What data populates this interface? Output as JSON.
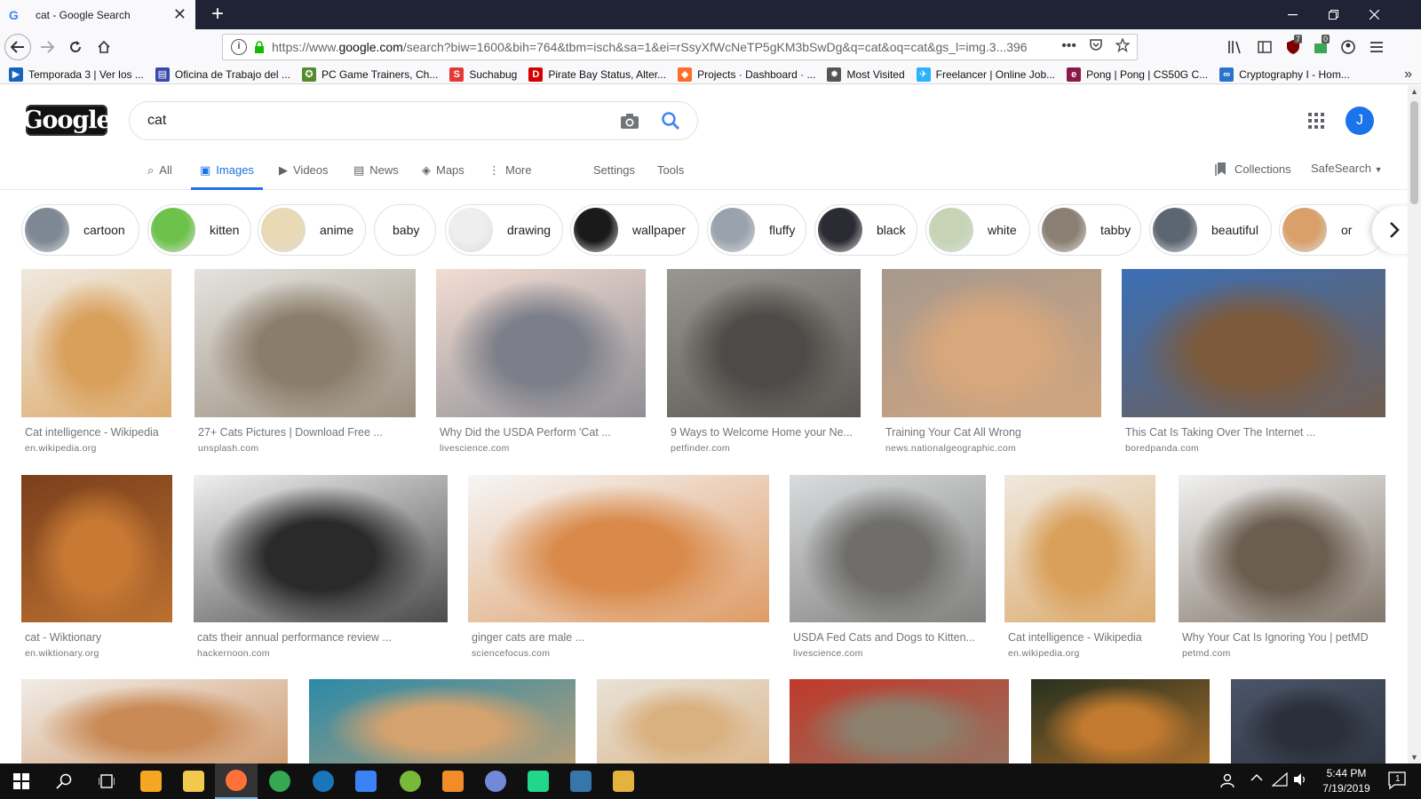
{
  "browser": {
    "tab_title": "cat - Google Search",
    "tab_favicon": "G",
    "tab_close": "✕",
    "new_tab": "+",
    "url_host_prefix": "https://www.",
    "url_host": "google.com",
    "url_path": "/search?biw=1600&bih=764&tbm=isch&sa=1&ei=rSsyXfWcNeTP5gKM3bSwDg&q=cat&oq=cat&gs_l=img.3...396",
    "url_more": "•••",
    "badge_ublock": "7",
    "badge_ext": "0"
  },
  "bookmarks": [
    {
      "label": "Temporada 3 | Ver los ...",
      "color": "#1565c0",
      "icon": "▶"
    },
    {
      "label": "Oficina de Trabajo del ...",
      "color": "#3949ab",
      "icon": "▤"
    },
    {
      "label": "PC Game Trainers, Ch...",
      "color": "#558b2f",
      "icon": "✪"
    },
    {
      "label": "Suchabug",
      "color": "#e53935",
      "icon": "S"
    },
    {
      "label": "Pirate Bay Status, Alter...",
      "color": "#d50000",
      "icon": "D"
    },
    {
      "label": "Projects · Dashboard · ...",
      "color": "#fc6d26",
      "icon": "◆"
    },
    {
      "label": "Most Visited",
      "color": "#555555",
      "icon": "✹"
    },
    {
      "label": "Freelancer | Online Job...",
      "color": "#29b2fe",
      "icon": "✈"
    },
    {
      "label": "Pong | Pong | CS50G C...",
      "color": "#8b1a4a",
      "icon": "e"
    },
    {
      "label": "Cryptography I - Hom...",
      "color": "#2a73cc",
      "icon": "∞"
    }
  ],
  "google": {
    "logo_text": "Google",
    "query": "cat",
    "avatar_letter": "J",
    "tabs": [
      {
        "label": "All",
        "icon": "⌕"
      },
      {
        "label": "Images",
        "icon": "▣"
      },
      {
        "label": "Videos",
        "icon": "▶"
      },
      {
        "label": "News",
        "icon": "▤"
      },
      {
        "label": "Maps",
        "icon": "◈"
      },
      {
        "label": "More",
        "icon": "⋮"
      }
    ],
    "settings": "Settings",
    "tools": "Tools",
    "collections": "Collections",
    "safesearch": "SafeSearch",
    "accent": "#1a73e8"
  },
  "chips": [
    {
      "label": "cartoon",
      "thumb": "#7d8894"
    },
    {
      "label": "kitten",
      "thumb": "#6cc24a"
    },
    {
      "label": "anime",
      "thumb": "#e9d9b4"
    },
    {
      "label": "baby",
      "thumb": ""
    },
    {
      "label": "drawing",
      "thumb": "#eeeeee"
    },
    {
      "label": "wallpaper",
      "thumb": "#1a1a1a"
    },
    {
      "label": "fluffy",
      "thumb": "#9aa3ad"
    },
    {
      "label": "black",
      "thumb": "#2b2b33"
    },
    {
      "label": "white",
      "thumb": "#c6d4b5"
    },
    {
      "label": "tabby",
      "thumb": "#8a7f72"
    },
    {
      "label": "beautiful",
      "thumb": "#5c6672"
    },
    {
      "label": "or",
      "thumb": "#d9a06a"
    }
  ],
  "results": [
    {
      "title": "Cat intelligence - Wikipedia",
      "domain": "en.wikipedia.org",
      "c1": "#d9a05b",
      "c2": "#efe9df"
    },
    {
      "title": "27+ Cats Pictures | Download Free ...",
      "domain": "unsplash.com",
      "c1": "#8b7d6b",
      "c2": "#e5e3df"
    },
    {
      "title": "Why Did the USDA Perform 'Cat ...",
      "domain": "livescience.com",
      "c1": "#7c7f89",
      "c2": "#f3ddd3"
    },
    {
      "title": "9 Ways to Welcome Home your Ne...",
      "domain": "petfinder.com",
      "c1": "#4d4b47",
      "c2": "#9a9791"
    },
    {
      "title": "Training Your Cat All Wrong",
      "domain": "news.nationalgeographic.com",
      "c1": "#d8a77c",
      "c2": "#a6998e"
    },
    {
      "title": "This Cat Is Taking Over The Internet ...",
      "domain": "boredpanda.com",
      "c1": "#7c5a3b",
      "c2": "#3b6fb6"
    },
    {
      "title": "cat - Wiktionary",
      "domain": "en.wiktionary.org",
      "c1": "#c87a34",
      "c2": "#7a3f1c"
    },
    {
      "title": "cats their annual performance review ...",
      "domain": "hackernoon.com",
      "c1": "#2a2a2a",
      "c2": "#f0f0f0"
    },
    {
      "title": "ginger cats are male ...",
      "domain": "sciencefocus.com",
      "c1": "#d98a4a",
      "c2": "#f6f6f6"
    },
    {
      "title": "USDA Fed Cats and Dogs to Kitten...",
      "domain": "livescience.com",
      "c1": "#6f6e6b",
      "c2": "#d9dcde"
    },
    {
      "title": "Cat intelligence - Wikipedia",
      "domain": "en.wikipedia.org",
      "c1": "#d9a05b",
      "c2": "#efe9df"
    },
    {
      "title": "Why Your Cat Is Ignoring You | petMD",
      "domain": "petmd.com",
      "c1": "#6b5d4f",
      "c2": "#f2f2f2"
    },
    {
      "title": "",
      "domain": "",
      "c1": "#c98a56",
      "c2": "#f1ede8"
    },
    {
      "title": "",
      "domain": "",
      "c1": "#d4a26e",
      "c2": "#2a8aa8"
    },
    {
      "title": "",
      "domain": "",
      "c1": "#d9b07f",
      "c2": "#e8e2d8"
    },
    {
      "title": "",
      "domain": "",
      "c1": "#8c7f6c",
      "c2": "#c0392b"
    },
    {
      "title": "",
      "domain": "",
      "c1": "#c17a2f",
      "c2": "#26301f"
    },
    {
      "title": "",
      "domain": "",
      "c1": "#2b2f3a",
      "c2": "#4a5568"
    }
  ],
  "taskbar": {
    "time": "5:44 PM",
    "date": "7/19/2019",
    "notif_count": "1",
    "apps": [
      {
        "name": "start",
        "color": "#ffffff"
      },
      {
        "name": "search",
        "color": "#ffffff"
      },
      {
        "name": "task-view",
        "color": "#ffffff"
      },
      {
        "name": "media-player",
        "color": "#f5a623"
      },
      {
        "name": "file-explorer",
        "color": "#f2c94c"
      },
      {
        "name": "firefox",
        "color": "#ff7139"
      },
      {
        "name": "chrome",
        "color": "#34a853"
      },
      {
        "name": "steam",
        "color": "#1b75bb"
      },
      {
        "name": "vs-installer",
        "color": "#3b82f6"
      },
      {
        "name": "utorrent",
        "color": "#78b83b"
      },
      {
        "name": "blender",
        "color": "#f28c28"
      },
      {
        "name": "discord",
        "color": "#7289da"
      },
      {
        "name": "pycharm",
        "color": "#21d789"
      },
      {
        "name": "python",
        "color": "#3776ab"
      },
      {
        "name": "paint",
        "color": "#e4b33d"
      }
    ]
  }
}
